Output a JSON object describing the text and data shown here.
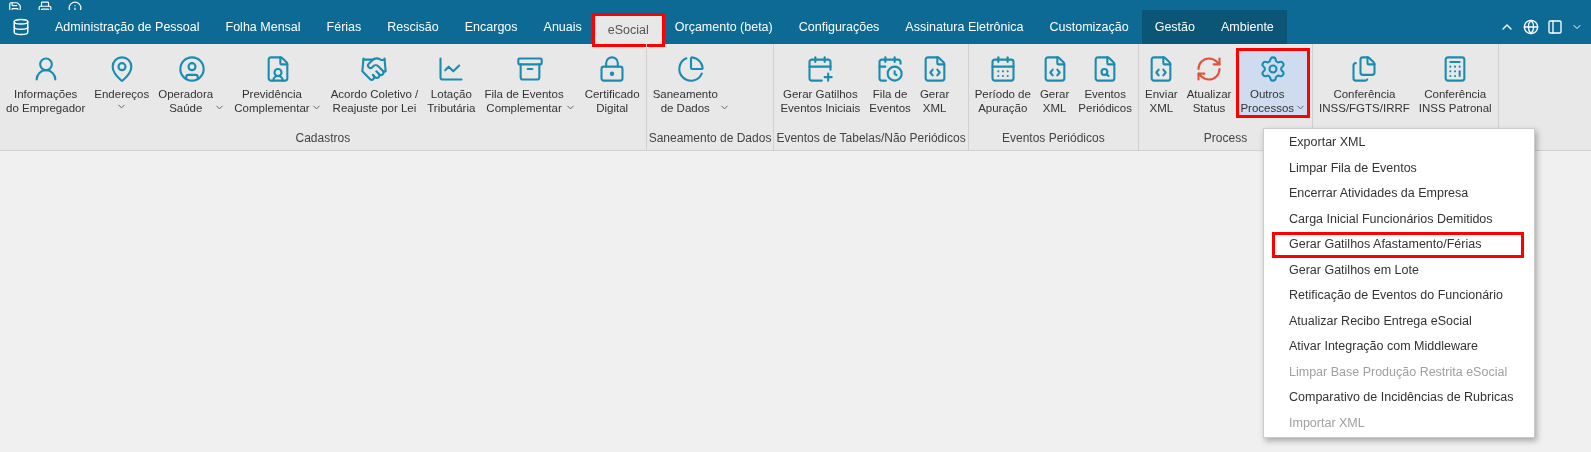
{
  "tabs": [
    {
      "label": "Administração de Pessoal",
      "selected": false,
      "highlighted": false,
      "contextual": false
    },
    {
      "label": "Folha Mensal",
      "selected": false,
      "highlighted": false,
      "contextual": false
    },
    {
      "label": "Férias",
      "selected": false,
      "highlighted": false,
      "contextual": false
    },
    {
      "label": "Rescisão",
      "selected": false,
      "highlighted": false,
      "contextual": false
    },
    {
      "label": "Encargos",
      "selected": false,
      "highlighted": false,
      "contextual": false
    },
    {
      "label": "Anuais",
      "selected": false,
      "highlighted": false,
      "contextual": false
    },
    {
      "label": "eSocial",
      "selected": true,
      "highlighted": true,
      "contextual": false
    },
    {
      "label": "Orçamento (beta)",
      "selected": false,
      "highlighted": false,
      "contextual": false
    },
    {
      "label": "Configurações",
      "selected": false,
      "highlighted": false,
      "contextual": false
    },
    {
      "label": "Assinatura Eletrônica",
      "selected": false,
      "highlighted": false,
      "contextual": false
    },
    {
      "label": "Customização",
      "selected": false,
      "highlighted": false,
      "contextual": false
    },
    {
      "label": "Gestão",
      "selected": false,
      "highlighted": false,
      "contextual": true
    },
    {
      "label": "Ambiente",
      "selected": false,
      "highlighted": false,
      "contextual": true
    }
  ],
  "ribbon_groups": [
    {
      "label": "Cadastros",
      "buttons": [
        {
          "label": "Informações\ndo Empregador",
          "dropdown": false,
          "pressed": false,
          "highlighted": false
        },
        {
          "label": "Endereços",
          "dropdown": true,
          "pressed": false,
          "highlighted": false
        },
        {
          "label": "Operadora\nSaúde",
          "dropdown": true,
          "pressed": false,
          "highlighted": false
        },
        {
          "label": "Previdência\nComplementar",
          "dropdown": true,
          "pressed": false,
          "highlighted": false
        },
        {
          "label": "Acordo Coletivo /\nReajuste por Lei",
          "dropdown": false,
          "pressed": false,
          "highlighted": false
        },
        {
          "label": "Lotação\nTributária",
          "dropdown": false,
          "pressed": false,
          "highlighted": false
        },
        {
          "label": "Fila de Eventos\nComplementar",
          "dropdown": true,
          "pressed": false,
          "highlighted": false
        },
        {
          "label": "Certificado\nDigital",
          "dropdown": false,
          "pressed": false,
          "highlighted": false
        }
      ]
    },
    {
      "label": "Saneamento de Dados",
      "buttons": [
        {
          "label": "Saneamento\nde Dados",
          "dropdown": true,
          "pressed": false,
          "highlighted": false
        }
      ]
    },
    {
      "label": "Eventos de Tabelas/Não Periódicos",
      "buttons": [
        {
          "label": "Gerar Gatilhos\nEventos Iniciais",
          "dropdown": false,
          "pressed": false,
          "highlighted": false
        },
        {
          "label": "Fila de\nEventos",
          "dropdown": false,
          "pressed": false,
          "highlighted": false
        },
        {
          "label": "Gerar\nXML",
          "dropdown": false,
          "pressed": false,
          "highlighted": false
        }
      ]
    },
    {
      "label": "Eventos Periódicos",
      "buttons": [
        {
          "label": "Período de\nApuração",
          "dropdown": false,
          "pressed": false,
          "highlighted": false
        },
        {
          "label": "Gerar\nXML",
          "dropdown": false,
          "pressed": false,
          "highlighted": false
        },
        {
          "label": "Eventos\nPeriódicos",
          "dropdown": false,
          "pressed": false,
          "highlighted": false
        }
      ]
    },
    {
      "label": "Process",
      "buttons": [
        {
          "label": "Enviar\nXML",
          "dropdown": false,
          "pressed": false,
          "highlighted": false
        },
        {
          "label": "Atualizar\nStatus",
          "dropdown": false,
          "pressed": false,
          "highlighted": false
        },
        {
          "label": "Outros\nProcessos",
          "dropdown": true,
          "pressed": true,
          "highlighted": true
        }
      ]
    },
    {
      "buttons": [
        {
          "label": "Conferência\nINSS/FGTS/IRRF",
          "dropdown": false,
          "pressed": false,
          "highlighted": false
        },
        {
          "label": "Conferência\nINSS Patronal",
          "dropdown": false,
          "pressed": false,
          "highlighted": false
        }
      ]
    }
  ],
  "menu": {
    "items": [
      {
        "label": "Exportar XML",
        "disabled": false,
        "highlighted": false
      },
      {
        "label": "Limpar Fila de Eventos",
        "disabled": false,
        "highlighted": false
      },
      {
        "label": "Encerrar Atividades da Empresa",
        "disabled": false,
        "highlighted": false
      },
      {
        "label": "Carga Inicial Funcionários Demitidos",
        "disabled": false,
        "highlighted": false
      },
      {
        "label": "Gerar Gatilhos Afastamento/Férias",
        "disabled": false,
        "highlighted": true
      },
      {
        "label": "Gerar Gatilhos em Lote",
        "disabled": false,
        "highlighted": false
      },
      {
        "label": "Retificação de Eventos do Funcionário",
        "disabled": false,
        "highlighted": false
      },
      {
        "label": "Atualizar Recibo Entrega eSocial",
        "disabled": false,
        "highlighted": false
      },
      {
        "label": "Ativar Integração com Middleware",
        "disabled": false,
        "highlighted": false
      },
      {
        "label": "Limpar Base Produção Restrita eSocial",
        "disabled": true,
        "highlighted": false
      },
      {
        "label": "Comparativo de Incidências de Rubricas",
        "disabled": false,
        "highlighted": false
      },
      {
        "label": "Importar XML",
        "disabled": true,
        "highlighted": false
      }
    ]
  }
}
